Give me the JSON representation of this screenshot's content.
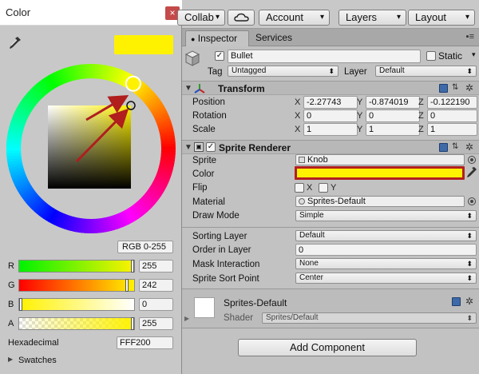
{
  "color_window": {
    "title": "Color",
    "close_glyph": "×",
    "current_color": "#FFF200",
    "mode": "RGB 0-255",
    "channels": [
      {
        "label": "R",
        "value": "255",
        "fraction": 1.0
      },
      {
        "label": "G",
        "value": "242",
        "fraction": 0.949
      },
      {
        "label": "B",
        "value": "0",
        "fraction": 0.0
      },
      {
        "label": "A",
        "value": "255",
        "fraction": 1.0
      }
    ],
    "hex_label": "Hexadecimal",
    "hex_value": "FFF200",
    "swatches_label": "Swatches"
  },
  "toolbar": {
    "collab": "Collab",
    "account": "Account",
    "layers": "Layers",
    "layout": "Layout",
    "caret": "▾"
  },
  "tabs": {
    "inspector": "Inspector",
    "services": "Services",
    "menu": "▪≡"
  },
  "game_object": {
    "name": "Bullet",
    "active": true,
    "static_label": "Static",
    "tag_label": "Tag",
    "tag_value": "Untagged",
    "layer_label": "Layer",
    "layer_value": "Default"
  },
  "transform": {
    "title": "Transform",
    "rows": [
      {
        "label": "Position",
        "x": "-2.27743",
        "y": "-0.874019",
        "z": "-0.122190"
      },
      {
        "label": "Rotation",
        "x": "0",
        "y": "0",
        "z": "0"
      },
      {
        "label": "Scale",
        "x": "1",
        "y": "1",
        "z": "1"
      }
    ],
    "axis_labels": [
      "X",
      "Y",
      "Z"
    ]
  },
  "sprite_renderer": {
    "title": "Sprite Renderer",
    "enabled": true,
    "sprite_label": "Sprite",
    "sprite_value": "Knob",
    "color_label": "Color",
    "color_value": "#FFF200",
    "highlight_color": "#B21F1F",
    "flip_label": "Flip",
    "flip_x": "X",
    "flip_y": "Y",
    "material_label": "Material",
    "material_value": "Sprites-Default",
    "draw_mode_label": "Draw Mode",
    "draw_mode_value": "Simple",
    "sorting_layer_label": "Sorting Layer",
    "sorting_layer_value": "Default",
    "order_label": "Order in Layer",
    "order_value": "0",
    "mask_label": "Mask Interaction",
    "mask_value": "None",
    "sort_point_label": "Sprite Sort Point",
    "sort_point_value": "Center"
  },
  "material_asset": {
    "name": "Sprites-Default",
    "shader_label": "Shader",
    "shader_value": "Sprites/Default"
  },
  "add_component": "Add Component",
  "icons": {
    "eyedropper": "eyedropper-icon",
    "cloud": "cloud-icon",
    "cube": "cube-icon",
    "gear": "gear-icon",
    "help": "help-book-icon",
    "preset": "preset-icon"
  }
}
